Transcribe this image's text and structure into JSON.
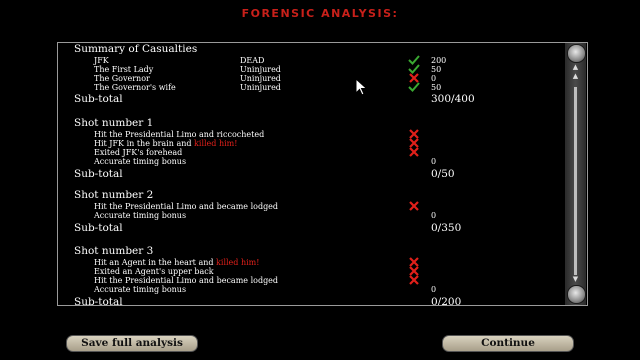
{
  "title": "FORENSIC ANALYSIS:",
  "summary": {
    "heading": "Summary of Casualties",
    "rows": [
      {
        "name": "JFK",
        "status": "DEAD",
        "result": "check",
        "points": "200"
      },
      {
        "name": "The First Lady",
        "status": "Uninjured",
        "result": "check",
        "points": "50"
      },
      {
        "name": "The Governor",
        "status": "Uninjured",
        "result": "cross",
        "points": "0"
      },
      {
        "name": "The Governor's wife",
        "status": "Uninjured",
        "result": "check",
        "points": "50"
      }
    ],
    "subtotal_label": "Sub-total",
    "subtotal": "300/400"
  },
  "shots": [
    {
      "heading": "Shot number 1",
      "lines": [
        {
          "text": "Hit the Presidential Limo and riccocheted",
          "red": "",
          "mark": "cross",
          "value": ""
        },
        {
          "text": "Hit JFK in the brain and ",
          "red": "killed him!",
          "mark": "cross",
          "value": ""
        },
        {
          "text": "Exited JFK's forehead",
          "red": "",
          "mark": "cross",
          "value": ""
        },
        {
          "text": "Accurate timing bonus",
          "red": "",
          "mark": "",
          "value": "0"
        }
      ],
      "subtotal_label": "Sub-total",
      "subtotal": "0/50"
    },
    {
      "heading": "Shot number 2",
      "lines": [
        {
          "text": "Hit the Presidential Limo and became lodged",
          "red": "",
          "mark": "cross",
          "value": ""
        },
        {
          "text": "Accurate timing bonus",
          "red": "",
          "mark": "",
          "value": "0"
        }
      ],
      "subtotal_label": "Sub-total",
      "subtotal": "0/350"
    },
    {
      "heading": "Shot number 3",
      "lines": [
        {
          "text": "Hit an Agent in the heart and ",
          "red": "killed him!",
          "mark": "cross",
          "value": ""
        },
        {
          "text": "Exited an Agent's upper back",
          "red": "",
          "mark": "cross",
          "value": ""
        },
        {
          "text": "Hit the Presidential Limo and became lodged",
          "red": "",
          "mark": "cross",
          "value": ""
        },
        {
          "text": "Accurate timing bonus",
          "red": "",
          "mark": "",
          "value": "0"
        }
      ],
      "subtotal_label": "Sub-total",
      "subtotal": "0/200"
    }
  ],
  "buttons": {
    "save": "Save full analysis",
    "continue": "Continue"
  },
  "colors": {
    "accent_red": "#e0201a",
    "check_green": "#3aa832",
    "button": "#c9c1ab"
  }
}
